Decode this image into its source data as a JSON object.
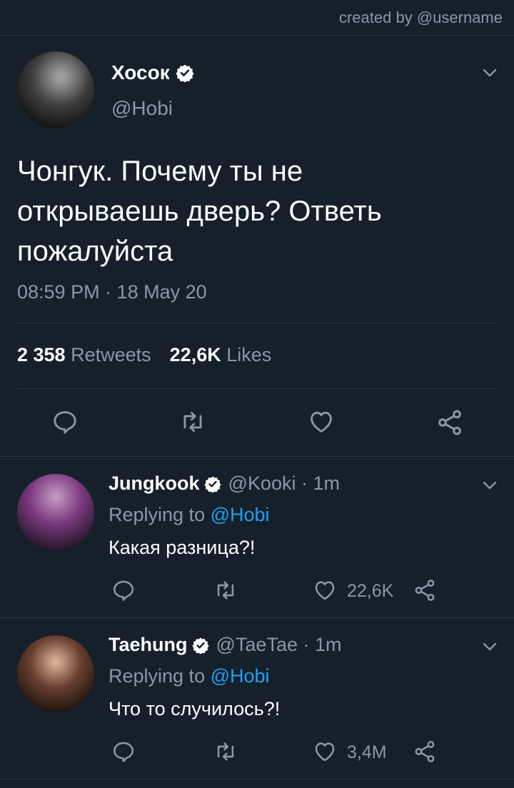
{
  "header": {
    "credit": "created by @username"
  },
  "main_tweet": {
    "name": "Хосок",
    "handle": "@Hobi",
    "text_lines": [
      "Чонгук. Почему ты не",
      "открываешь дверь? Ответь",
      "пожалуйста"
    ],
    "timestamp": "08:59 PM · 18 May 20",
    "retweets_count": "2 358",
    "retweets_label": "Retweets",
    "likes_count": "22,6K",
    "likes_label": "Likes"
  },
  "replies": [
    {
      "name": "Jungkook",
      "handle": "@Kooki · 1m",
      "replying_prefix": "Replying to",
      "replying_to": "@Hobi",
      "text": "Какая разница?!",
      "likes": "22,6K"
    },
    {
      "name": "Taehung",
      "handle": "@TaeTae · 1m",
      "replying_prefix": "Replying to",
      "replying_to": "@Hobi",
      "text": "Что то случилось?!",
      "likes": "3,4M"
    }
  ],
  "colors": {
    "background": "#15202b",
    "secondary_text": "#8899a6",
    "link": "#1da1f2",
    "divider": "#2a3744"
  },
  "icons": [
    "verified-icon",
    "chevron-down-icon",
    "reply-icon",
    "retweet-icon",
    "like-icon",
    "share-icon"
  ]
}
